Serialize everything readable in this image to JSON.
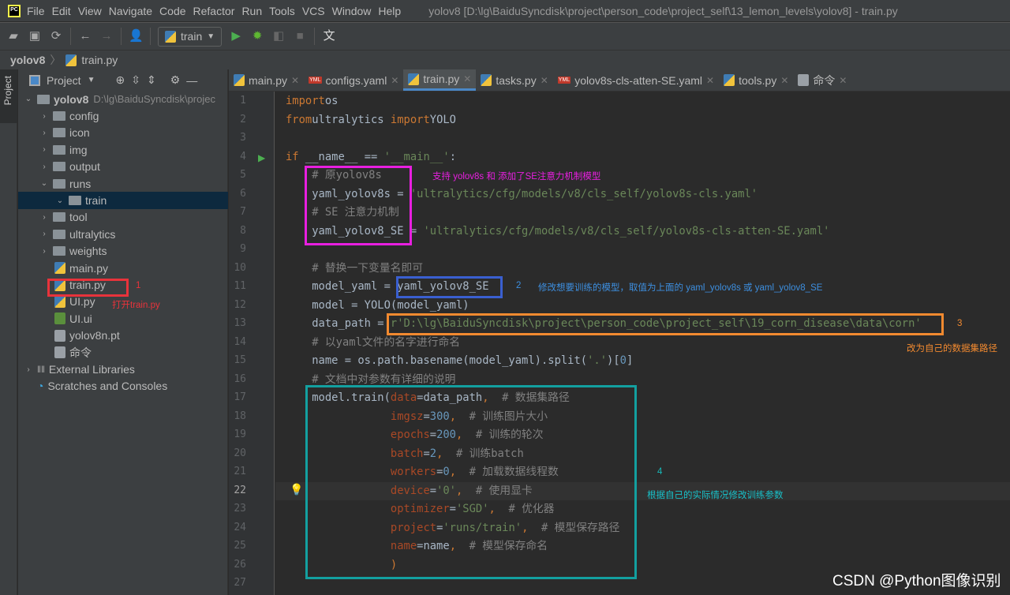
{
  "menubar": {
    "items": [
      "File",
      "Edit",
      "View",
      "Navigate",
      "Code",
      "Refactor",
      "Run",
      "Tools",
      "VCS",
      "Window",
      "Help"
    ],
    "title": "yolov8 [D:\\lg\\BaiduSyncdisk\\project\\person_code\\project_self\\13_lemon_levels\\yolov8] - train.py"
  },
  "toolbar": {
    "run_config": "train"
  },
  "breadcrumb": {
    "project": "yolov8",
    "file": "train.py"
  },
  "stripe": {
    "label": "Project"
  },
  "project": {
    "header": "Project",
    "items": [
      {
        "label": "yolov8",
        "hint": "D:\\lg\\BaiduSyncdisk\\projec",
        "type": "folder",
        "depth": 0,
        "arrow": "v",
        "bold": true
      },
      {
        "label": "config",
        "type": "folder",
        "depth": 1,
        "arrow": ">"
      },
      {
        "label": "icon",
        "type": "folder",
        "depth": 1,
        "arrow": ">"
      },
      {
        "label": "img",
        "type": "folder",
        "depth": 1,
        "arrow": ">"
      },
      {
        "label": "output",
        "type": "folder",
        "depth": 1,
        "arrow": ">"
      },
      {
        "label": "runs",
        "type": "folder",
        "depth": 1,
        "arrow": "v"
      },
      {
        "label": "train",
        "type": "folder",
        "depth": 2,
        "arrow": "v",
        "selected": true
      },
      {
        "label": "tool",
        "type": "folder",
        "depth": 1,
        "arrow": ">"
      },
      {
        "label": "ultralytics",
        "type": "folder",
        "depth": 1,
        "arrow": ">"
      },
      {
        "label": "weights",
        "type": "folder",
        "depth": 1,
        "arrow": ">"
      },
      {
        "label": "main.py",
        "type": "py",
        "depth": 1
      },
      {
        "label": "train.py",
        "type": "py",
        "depth": 1
      },
      {
        "label": "UI.py",
        "type": "py",
        "depth": 1
      },
      {
        "label": "UI.ui",
        "type": "ui",
        "depth": 1
      },
      {
        "label": "yolov8n.pt",
        "type": "txt",
        "depth": 1
      },
      {
        "label": "命令",
        "type": "txt",
        "depth": 1
      },
      {
        "label": "External Libraries",
        "type": "lib",
        "depth": 0,
        "arrow": ">"
      },
      {
        "label": "Scratches and Consoles",
        "type": "scratch",
        "depth": 0
      }
    ]
  },
  "tabs": [
    {
      "label": "main.py",
      "type": "py"
    },
    {
      "label": "configs.yaml",
      "type": "yaml"
    },
    {
      "label": "train.py",
      "type": "py",
      "active": true
    },
    {
      "label": "tasks.py",
      "type": "py"
    },
    {
      "label": "yolov8s-cls-atten-SE.yaml",
      "type": "yaml"
    },
    {
      "label": "tools.py",
      "type": "py"
    },
    {
      "label": "命令",
      "type": "txt"
    }
  ],
  "editor": {
    "current_line": 22,
    "lines": [
      [
        [
          "kw",
          "import"
        ],
        [
          "",
          "os"
        ]
      ],
      [
        [
          "kw",
          "from"
        ],
        [
          "",
          "ultralytics "
        ],
        [
          "kw",
          "import"
        ],
        [
          "",
          "YOLO"
        ]
      ],
      [],
      [
        [
          "kw",
          "if"
        ],
        [
          "",
          " __name__ == "
        ],
        [
          "str",
          "'__main__'"
        ],
        [
          "",
          ":"
        ]
      ],
      [
        [
          "",
          "    "
        ],
        [
          "cm",
          "# 原yolov8s"
        ]
      ],
      [
        [
          "",
          "    yaml_yolov8s = "
        ],
        [
          "str",
          "'ultralytics/cfg/models/v8/cls_self/yolov8s-cls.yaml'"
        ]
      ],
      [
        [
          "",
          "    "
        ],
        [
          "cm",
          "# SE 注意力机制"
        ]
      ],
      [
        [
          "",
          "    yaml_yolov8_SE = "
        ],
        [
          "str",
          "'ultralytics/cfg/models/v8/cls_self/yolov8s-cls-atten-SE.yaml'"
        ]
      ],
      [],
      [
        [
          "",
          "    "
        ],
        [
          "cm",
          "# 替换一下变量名即可"
        ]
      ],
      [
        [
          "",
          "    model_yaml = yaml_yolov8_SE"
        ]
      ],
      [
        [
          "",
          "    model = YOLO(model_yaml)"
        ]
      ],
      [
        [
          "",
          "    data_path = "
        ],
        [
          "str",
          "r'D:\\lg\\BaiduSyncdisk\\project\\person_code\\project_self\\19_corn_disease\\data\\corn'"
        ]
      ],
      [
        [
          "",
          "    "
        ],
        [
          "cm",
          "# 以yaml文件的名字进行命名"
        ]
      ],
      [
        [
          "",
          "    name = os.path.basename(model_yaml).split("
        ],
        [
          "str",
          "'.'"
        ],
        [
          "",
          ")["
        ],
        [
          "num",
          "0"
        ],
        [
          "",
          "]"
        ]
      ],
      [
        [
          "",
          "    "
        ],
        [
          "cm",
          "# 文档中对参数有详细的说明"
        ]
      ],
      [
        [
          "",
          "    model.train("
        ],
        [
          "pa",
          "data"
        ],
        [
          "",
          "=data_path"
        ],
        [
          "kw",
          ","
        ],
        [
          "",
          "  "
        ],
        [
          "cm",
          "# 数据集路径"
        ]
      ],
      [
        [
          "",
          "                "
        ],
        [
          "pa",
          "imgsz"
        ],
        [
          "",
          "="
        ],
        [
          "num",
          "300"
        ],
        [
          "kw",
          ","
        ],
        [
          "",
          "  "
        ],
        [
          "cm",
          "# 训练图片大小"
        ]
      ],
      [
        [
          "",
          "                "
        ],
        [
          "pa",
          "epochs"
        ],
        [
          "",
          "="
        ],
        [
          "num",
          "200"
        ],
        [
          "kw",
          ","
        ],
        [
          "",
          "  "
        ],
        [
          "cm",
          "# 训练的轮次"
        ]
      ],
      [
        [
          "",
          "                "
        ],
        [
          "pa",
          "batch"
        ],
        [
          "",
          "="
        ],
        [
          "num",
          "2"
        ],
        [
          "kw",
          ","
        ],
        [
          "",
          "  "
        ],
        [
          "cm",
          "# 训练batch"
        ]
      ],
      [
        [
          "",
          "                "
        ],
        [
          "pa",
          "workers"
        ],
        [
          "",
          "="
        ],
        [
          "num",
          "0"
        ],
        [
          "kw",
          ","
        ],
        [
          "",
          "  "
        ],
        [
          "cm",
          "# 加载数据线程数"
        ]
      ],
      [
        [
          "",
          "                "
        ],
        [
          "pa",
          "device"
        ],
        [
          "",
          "="
        ],
        [
          "str",
          "'0'"
        ],
        [
          "kw",
          ","
        ],
        [
          "",
          "  "
        ],
        [
          "cm",
          "# 使用显卡"
        ]
      ],
      [
        [
          "",
          "                "
        ],
        [
          "pa",
          "optimizer"
        ],
        [
          "",
          "="
        ],
        [
          "str",
          "'SGD'"
        ],
        [
          "kw",
          ","
        ],
        [
          "",
          "  "
        ],
        [
          "cm",
          "# 优化器"
        ]
      ],
      [
        [
          "",
          "                "
        ],
        [
          "pa",
          "project"
        ],
        [
          "",
          "="
        ],
        [
          "str",
          "'runs/train'"
        ],
        [
          "kw",
          ","
        ],
        [
          "",
          "  "
        ],
        [
          "cm",
          "# 模型保存路径"
        ]
      ],
      [
        [
          "",
          "                "
        ],
        [
          "pa",
          "name"
        ],
        [
          "",
          "=name"
        ],
        [
          "kw",
          ","
        ],
        [
          "",
          "  "
        ],
        [
          "cm",
          "# 模型保存命名"
        ]
      ],
      [
        [
          "",
          "                "
        ],
        [
          "kw",
          ")"
        ]
      ],
      []
    ]
  },
  "annotations": {
    "n1": "1",
    "t1": "打开train.py",
    "t_magenta": "支持 yolov8s 和 添加了SE注意力机制模型",
    "n2": "2",
    "t2": "修改想要训练的模型，取值为上面的 yaml_yolov8s 或 yaml_yolov8_SE",
    "n3": "3",
    "t3": "改为自己的数据集路径",
    "n4": "4",
    "t4": "根据自己的实际情况修改训练参数",
    "colors": {
      "red": "#e8333b",
      "magenta": "#e81fe0",
      "blue": "#3a5fd0",
      "orange": "#f28a30",
      "teal": "#13a0a0"
    }
  },
  "watermark": "CSDN @Python图像识别"
}
